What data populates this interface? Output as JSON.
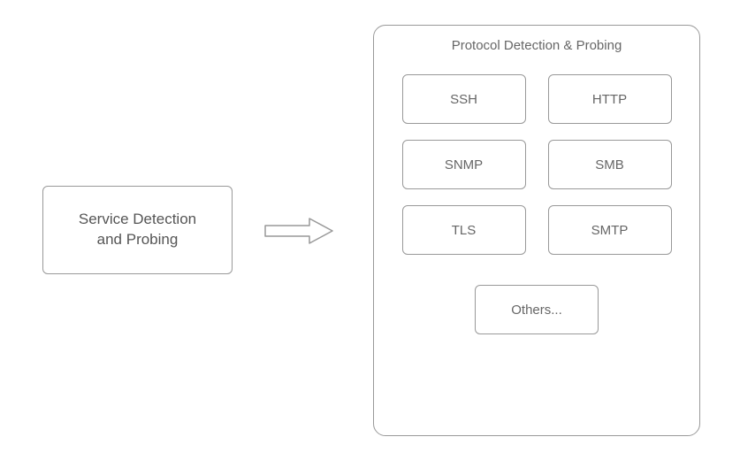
{
  "left_box": {
    "label": "Service Detection\nand Probing"
  },
  "container": {
    "title": "Protocol Detection & Probing"
  },
  "protocols": {
    "row1": [
      "SSH",
      "HTTP"
    ],
    "row2": [
      "SNMP",
      "SMB"
    ],
    "row3": [
      "TLS",
      "SMTP"
    ],
    "others": "Others..."
  }
}
